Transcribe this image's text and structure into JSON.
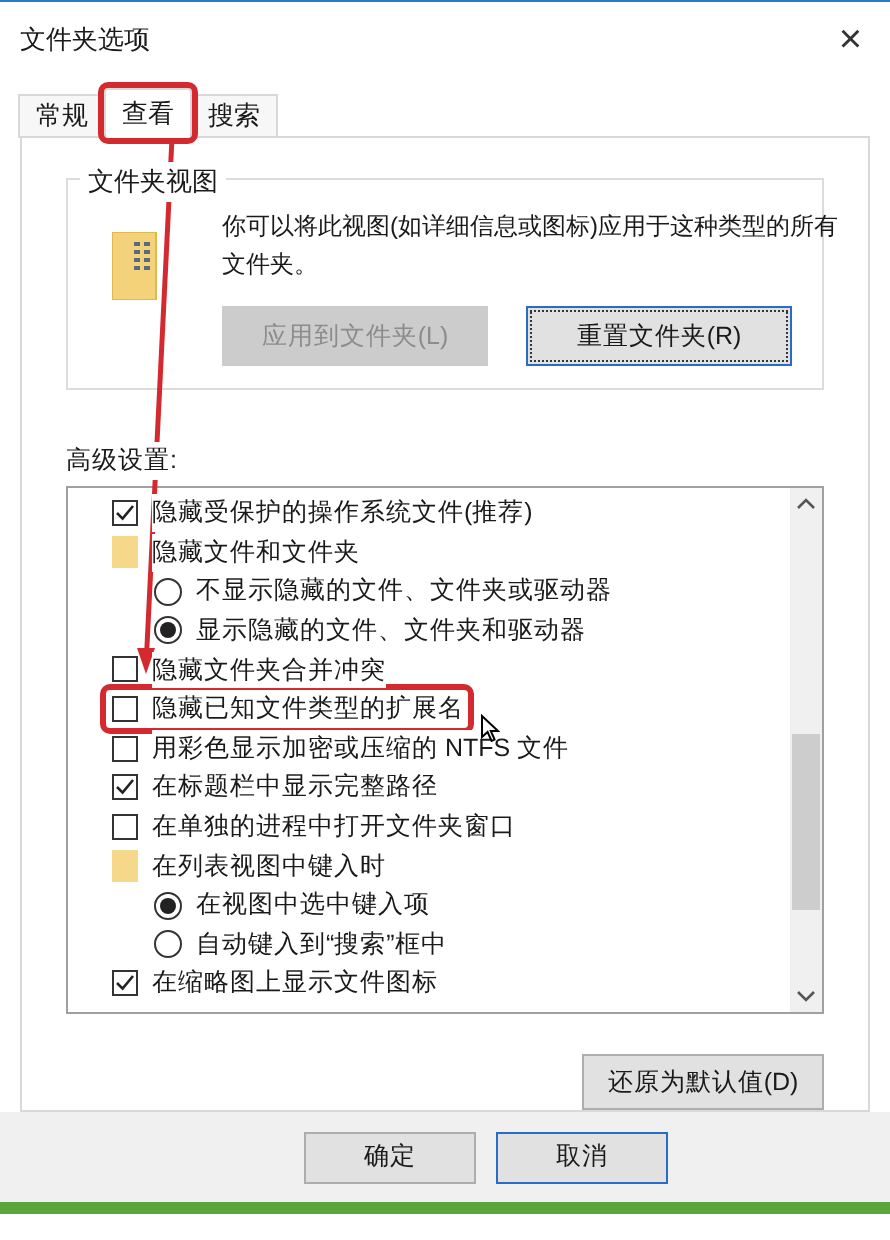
{
  "window": {
    "title": "文件夹选项",
    "close": "×"
  },
  "tabs": [
    {
      "label": "常规",
      "selected": false,
      "highlighted": false
    },
    {
      "label": "查看",
      "selected": true,
      "highlighted": true
    },
    {
      "label": "搜索",
      "selected": false,
      "highlighted": false
    }
  ],
  "folder_views": {
    "title": "文件夹视图",
    "description": "你可以将此视图(如详细信息或图标)应用于这种类型的所有文件夹。",
    "buttons": [
      {
        "label": "应用到文件夹(L)",
        "disabled": true,
        "focused": false
      },
      {
        "label": "重置文件夹(R)",
        "disabled": false,
        "focused": true
      }
    ]
  },
  "advanced": {
    "title": "高级设置:",
    "items": [
      {
        "kind": "checkbox",
        "label": "隐藏受保护的操作系统文件(推荐)",
        "checked": true,
        "highlighted": false
      },
      {
        "kind": "folder",
        "label": "隐藏文件和文件夹",
        "children": [
          {
            "kind": "radio",
            "label": "不显示隐藏的文件、文件夹或驱动器",
            "selected": false
          },
          {
            "kind": "radio",
            "label": "显示隐藏的文件、文件夹和驱动器",
            "selected": true
          }
        ]
      },
      {
        "kind": "checkbox",
        "label": "隐藏文件夹合并冲突",
        "checked": false,
        "highlighted": false
      },
      {
        "kind": "checkbox",
        "label": "隐藏已知文件类型的扩展名",
        "checked": false,
        "highlighted": true
      },
      {
        "kind": "checkbox",
        "label": "用彩色显示加密或压缩的 NTFS 文件",
        "checked": false,
        "highlighted": false
      },
      {
        "kind": "checkbox",
        "label": "在标题栏中显示完整路径",
        "checked": true,
        "highlighted": false
      },
      {
        "kind": "checkbox",
        "label": "在单独的进程中打开文件夹窗口",
        "checked": false,
        "highlighted": false
      },
      {
        "kind": "folder",
        "label": "在列表视图中键入时",
        "children": [
          {
            "kind": "radio",
            "label": "在视图中选中键入项",
            "selected": true
          },
          {
            "kind": "radio",
            "label": "自动键入到“搜索”框中",
            "selected": false
          }
        ]
      },
      {
        "kind": "checkbox",
        "label": "在缩略图上显示文件图标",
        "checked": true,
        "highlighted": false
      }
    ]
  },
  "restore_button": "还原为默认值(D)",
  "footer_buttons": [
    "确定",
    "取消"
  ]
}
